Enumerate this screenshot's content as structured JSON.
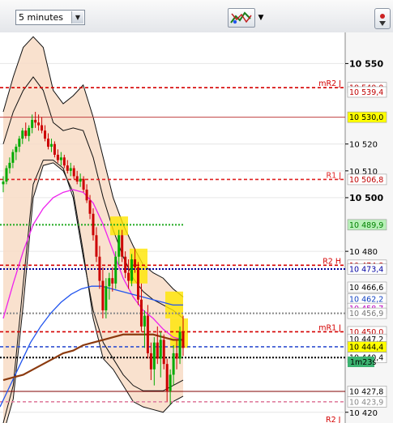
{
  "toolbar": {
    "timeframe": "5 minutes",
    "indicators_icon": "indicators-icon",
    "dropdown_icon": "chevron-down-icon",
    "right_icon": "scroll-right-icon"
  },
  "axis": {
    "ticks": [
      {
        "label": "10 550",
        "price": 10550,
        "bold": true
      },
      {
        "label": "10 520",
        "price": 10520,
        "bold": false
      },
      {
        "label": "10 510",
        "price": 10510,
        "bold": false
      },
      {
        "label": "10 500",
        "price": 10500,
        "bold": true
      },
      {
        "label": "10 480",
        "price": 10480,
        "bold": false
      },
      {
        "label": "10 420",
        "price": 10420,
        "bold": false
      }
    ]
  },
  "levels": [
    {
      "name": "mR2 J",
      "price": 10541,
      "color": "#d40000",
      "style": "dash",
      "label": "10 540,0",
      "bg": "#ffffff",
      "fg": "#c00000"
    },
    {
      "name": "",
      "price": 10539.4,
      "color": "#d40000",
      "style": "none",
      "label": "10 539,4",
      "bg": "#ffffff",
      "fg": "#c00000"
    },
    {
      "name": "",
      "price": 10530,
      "color": "#c04040",
      "style": "solid",
      "label": "10 530,0",
      "bg": "#ffff00",
      "fg": "#000000"
    },
    {
      "name": "R1 J",
      "price": 10506.8,
      "color": "#e02020",
      "style": "dash",
      "label": "10 506,8",
      "bg": "#ffffff",
      "fg": "#c00000"
    },
    {
      "name": "",
      "price": 10489.9,
      "color": "#22aa22",
      "style": "dot",
      "label": "10 489,9",
      "bg": "#b8f0b8",
      "fg": "#008000"
    },
    {
      "name": "R2 H",
      "price": 10474.8,
      "color": "#d40000",
      "style": "dash",
      "label": "10 474,8",
      "bg": "#ffffff",
      "fg": "#c00000"
    },
    {
      "name": "",
      "price": 10473.4,
      "color": "#000099",
      "style": "dot",
      "label": "10 473,4",
      "bg": "#ffffff",
      "fg": "#0000a0"
    },
    {
      "name": "",
      "price": 10466.6,
      "color": "#444444",
      "style": "none",
      "label": "10 466,6",
      "bg": "#ffffff",
      "fg": "#000000"
    },
    {
      "name": "",
      "price": 10462.2,
      "color": "#3060e0",
      "style": "none",
      "label": "10 462,2",
      "bg": "#ffffff",
      "fg": "#1040c0"
    },
    {
      "name": "",
      "price": 10458.7,
      "color": "#e030e0",
      "style": "none",
      "label": "10 458,7",
      "bg": "#ffffff",
      "fg": "#c000c0"
    },
    {
      "name": "",
      "price": 10456.9,
      "color": "#888888",
      "style": "dot",
      "label": "10 456,9",
      "bg": "#ffffff",
      "fg": "#777777"
    },
    {
      "name": "mR1 J",
      "price": 10450,
      "color": "#d40000",
      "style": "dash",
      "label": "10 450,0",
      "bg": "#ffffff",
      "fg": "#c00000"
    },
    {
      "name": "",
      "price": 10447.2,
      "color": "#8b3a0f",
      "style": "none",
      "label": "10 447,2",
      "bg": "#ffffff",
      "fg": "#000000"
    },
    {
      "name": "",
      "price": 10444.4,
      "color": "#3050d0",
      "style": "dash",
      "label": "10 444,4",
      "bg": "#ffff00",
      "fg": "#000000"
    },
    {
      "name": "",
      "price": 10440.4,
      "color": "#000000",
      "style": "dot",
      "label": "10 440,4",
      "bg": "#ffffff",
      "fg": "#000000"
    },
    {
      "name": "",
      "price": 10427.8,
      "color": "#800000",
      "style": "solid",
      "label": "10 427,8",
      "bg": "#ffffff",
      "fg": "#000000"
    },
    {
      "name": "",
      "price": 10423.9,
      "color": "#e080a0",
      "style": "dash",
      "label": "10 423,9",
      "bg": "#ffffff",
      "fg": "#888888"
    }
  ],
  "timer": {
    "label": "1m23s",
    "bg": "#3cb371"
  },
  "bottom_partial": "R2 J",
  "colors": {
    "bg_band": "#f8dcc6",
    "up": "#00aa00",
    "down": "#cc0000",
    "ma_magenta": "#ee22ee",
    "ma_blue": "#2255ee",
    "ma_brown": "#8b3a0f"
  },
  "chart_data": {
    "type": "candlestick",
    "ylim": [
      10416,
      10561
    ],
    "candles": [
      {
        "o": 10505,
        "h": 10508,
        "l": 10502,
        "c": 10506
      },
      {
        "o": 10506,
        "h": 10512,
        "l": 10505,
        "c": 10511
      },
      {
        "o": 10511,
        "h": 10515,
        "l": 10509,
        "c": 10513
      },
      {
        "o": 10513,
        "h": 10518,
        "l": 10511,
        "c": 10517
      },
      {
        "o": 10517,
        "h": 10520,
        "l": 10514,
        "c": 10519
      },
      {
        "o": 10519,
        "h": 10523,
        "l": 10517,
        "c": 10522
      },
      {
        "o": 10522,
        "h": 10526,
        "l": 10520,
        "c": 10525
      },
      {
        "o": 10525,
        "h": 10528,
        "l": 10522,
        "c": 10523
      },
      {
        "o": 10523,
        "h": 10527,
        "l": 10521,
        "c": 10526
      },
      {
        "o": 10526,
        "h": 10531,
        "l": 10524,
        "c": 10529
      },
      {
        "o": 10529,
        "h": 10532,
        "l": 10526,
        "c": 10528
      },
      {
        "o": 10528,
        "h": 10531,
        "l": 10525,
        "c": 10527
      },
      {
        "o": 10527,
        "h": 10530,
        "l": 10524,
        "c": 10525
      },
      {
        "o": 10525,
        "h": 10527,
        "l": 10521,
        "c": 10522
      },
      {
        "o": 10522,
        "h": 10524,
        "l": 10518,
        "c": 10519
      },
      {
        "o": 10519,
        "h": 10522,
        "l": 10517,
        "c": 10520
      },
      {
        "o": 10520,
        "h": 10521,
        "l": 10515,
        "c": 10516
      },
      {
        "o": 10516,
        "h": 10518,
        "l": 10513,
        "c": 10514
      },
      {
        "o": 10514,
        "h": 10517,
        "l": 10512,
        "c": 10515
      },
      {
        "o": 10515,
        "h": 10516,
        "l": 10511,
        "c": 10512
      },
      {
        "o": 10512,
        "h": 10514,
        "l": 10509,
        "c": 10510
      },
      {
        "o": 10510,
        "h": 10513,
        "l": 10508,
        "c": 10511
      },
      {
        "o": 10511,
        "h": 10512,
        "l": 10507,
        "c": 10508
      },
      {
        "o": 10508,
        "h": 10510,
        "l": 10505,
        "c": 10506
      },
      {
        "o": 10506,
        "h": 10509,
        "l": 10504,
        "c": 10507
      },
      {
        "o": 10507,
        "h": 10508,
        "l": 10502,
        "c": 10503
      },
      {
        "o": 10503,
        "h": 10505,
        "l": 10498,
        "c": 10499
      },
      {
        "o": 10499,
        "h": 10501,
        "l": 10492,
        "c": 10494
      },
      {
        "o": 10494,
        "h": 10496,
        "l": 10484,
        "c": 10486
      },
      {
        "o": 10486,
        "h": 10489,
        "l": 10476,
        "c": 10478
      },
      {
        "o": 10478,
        "h": 10482,
        "l": 10466,
        "c": 10469
      },
      {
        "o": 10469,
        "h": 10474,
        "l": 10455,
        "c": 10458
      },
      {
        "o": 10458,
        "h": 10470,
        "l": 10455,
        "c": 10467
      },
      {
        "o": 10467,
        "h": 10472,
        "l": 10462,
        "c": 10470
      },
      {
        "o": 10470,
        "h": 10474,
        "l": 10465,
        "c": 10468
      },
      {
        "o": 10468,
        "h": 10480,
        "l": 10466,
        "c": 10478
      },
      {
        "o": 10478,
        "h": 10488,
        "l": 10475,
        "c": 10486
      },
      {
        "o": 10486,
        "h": 10488,
        "l": 10476,
        "c": 10478
      },
      {
        "o": 10478,
        "h": 10480,
        "l": 10470,
        "c": 10472
      },
      {
        "o": 10472,
        "h": 10477,
        "l": 10466,
        "c": 10469
      },
      {
        "o": 10469,
        "h": 10479,
        "l": 10467,
        "c": 10477
      },
      {
        "o": 10477,
        "h": 10481,
        "l": 10472,
        "c": 10474
      },
      {
        "o": 10474,
        "h": 10476,
        "l": 10460,
        "c": 10462
      },
      {
        "o": 10462,
        "h": 10468,
        "l": 10450,
        "c": 10452
      },
      {
        "o": 10452,
        "h": 10458,
        "l": 10444,
        "c": 10456
      },
      {
        "o": 10456,
        "h": 10460,
        "l": 10440,
        "c": 10442
      },
      {
        "o": 10442,
        "h": 10446,
        "l": 10432,
        "c": 10436
      },
      {
        "o": 10436,
        "h": 10448,
        "l": 10430,
        "c": 10446
      },
      {
        "o": 10446,
        "h": 10452,
        "l": 10438,
        "c": 10440
      },
      {
        "o": 10440,
        "h": 10450,
        "l": 10433,
        "c": 10447
      },
      {
        "o": 10447,
        "h": 10449,
        "l": 10436,
        "c": 10438
      },
      {
        "o": 10438,
        "h": 10440,
        "l": 10424,
        "c": 10428
      },
      {
        "o": 10428,
        "h": 10436,
        "l": 10423,
        "c": 10434
      },
      {
        "o": 10434,
        "h": 10445,
        "l": 10430,
        "c": 10442
      },
      {
        "o": 10442,
        "h": 10447,
        "l": 10436,
        "c": 10440
      },
      {
        "o": 10440,
        "h": 10452,
        "l": 10438,
        "c": 10450
      },
      {
        "o": 10450,
        "h": 10456,
        "l": 10441,
        "c": 10444
      }
    ],
    "series": [
      {
        "name": "",
        "color": "#ee22ee",
        "values": [
          10455,
          10468,
          10480,
          10490,
          10496,
          10500,
          10502,
          10503,
          10502,
          10498,
          10490,
          10480,
          10470,
          10463,
          10458,
          10455,
          10451,
          10448,
          10447
        ]
      },
      {
        "name": "",
        "color": "#2255ee",
        "values": [
          10422,
          10430,
          10438,
          10446,
          10452,
          10457,
          10461,
          10464,
          10466,
          10467,
          10467,
          10466,
          10465,
          10464,
          10463,
          10462,
          10461,
          10460,
          10460
        ]
      },
      {
        "name": "",
        "color": "#8b3a0f",
        "values": [
          10432,
          10433,
          10434,
          10436,
          10438,
          10440,
          10442,
          10443,
          10445,
          10446,
          10447,
          10448,
          10449,
          10449,
          10449,
          10449,
          10448,
          10447,
          10447
        ]
      }
    ],
    "bollinger": {
      "upper": [
        10532,
        10545,
        10556,
        10560,
        10556,
        10540,
        10535,
        10538,
        10542,
        10530,
        10515,
        10500,
        10490,
        10482,
        10475,
        10472,
        10470,
        10466,
        10463
      ],
      "lower": [
        10412,
        10425,
        10460,
        10500,
        10512,
        10513,
        10510,
        10502,
        10480,
        10455,
        10440,
        10436,
        10430,
        10424,
        10422,
        10421,
        10420,
        10424,
        10426
      ],
      "inner_upper": [
        10520,
        10532,
        10540,
        10545,
        10540,
        10528,
        10525,
        10526,
        10525,
        10515,
        10500,
        10488,
        10478,
        10470,
        10465,
        10462,
        10460,
        10458,
        10455
      ],
      "inner_lower": [
        10416,
        10430,
        10468,
        10505,
        10514,
        10514,
        10511,
        10500,
        10478,
        10458,
        10446,
        10440,
        10434,
        10430,
        10428,
        10428,
        10428,
        10430,
        10432
      ]
    },
    "highlight_zones": [
      {
        "from": 10486,
        "to": 10493
      },
      {
        "from": 10468,
        "to": 10481
      },
      {
        "from": 10455,
        "to": 10465
      },
      {
        "from": 10444,
        "to": 10455
      }
    ]
  }
}
